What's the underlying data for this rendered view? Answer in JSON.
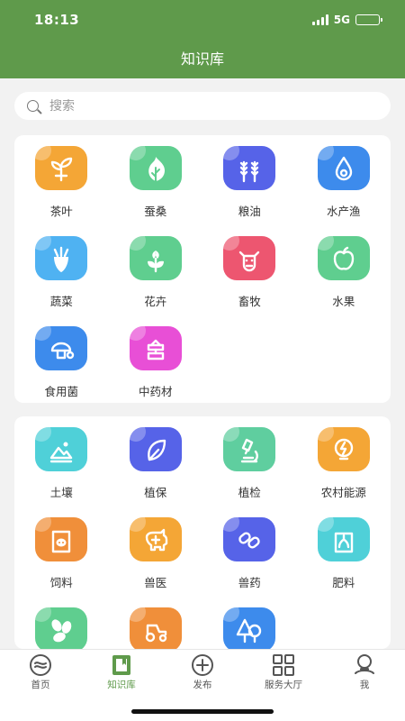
{
  "status": {
    "time": "18:13",
    "network": "5G"
  },
  "header": {
    "title": "知识库"
  },
  "search": {
    "placeholder": "搜索"
  },
  "section1": {
    "items": [
      {
        "label": "茶叶",
        "icon": "tea-sprout-icon",
        "color": "#f4a636"
      },
      {
        "label": "蚕桑",
        "icon": "mulberry-leaf-icon",
        "color": "#5fce8f"
      },
      {
        "label": "粮油",
        "icon": "wheat-icon",
        "color": "#5663e8"
      },
      {
        "label": "水产渔",
        "icon": "water-drop-icon",
        "color": "#3d8bec"
      },
      {
        "label": "蔬菜",
        "icon": "radish-icon",
        "color": "#4fb2f2"
      },
      {
        "label": "花卉",
        "icon": "flower-icon",
        "color": "#5fce8f"
      },
      {
        "label": "畜牧",
        "icon": "cow-icon",
        "color": "#ed5670"
      },
      {
        "label": "水果",
        "icon": "apple-icon",
        "color": "#5fce8f"
      },
      {
        "label": "食用菌",
        "icon": "mushroom-icon",
        "color": "#3d8bec"
      },
      {
        "label": "中药材",
        "icon": "herb-bundle-icon",
        "color": "#e84fd6"
      }
    ]
  },
  "section2": {
    "items": [
      {
        "label": "土壤",
        "icon": "soil-icon",
        "color": "#4fd0d8"
      },
      {
        "label": "植保",
        "icon": "leaf-protect-icon",
        "color": "#5663e8"
      },
      {
        "label": "植检",
        "icon": "microscope-icon",
        "color": "#5fce9f"
      },
      {
        "label": "农村能源",
        "icon": "energy-bulb-icon",
        "color": "#f4a636"
      },
      {
        "label": "饲料",
        "icon": "feed-bag-icon",
        "color": "#f08f3a"
      },
      {
        "label": "兽医",
        "icon": "vet-pig-icon",
        "color": "#f4a636"
      },
      {
        "label": "兽药",
        "icon": "pills-icon",
        "color": "#5663e8"
      },
      {
        "label": "肥料",
        "icon": "fertilizer-icon",
        "color": "#4fd0d8"
      },
      {
        "label": "",
        "icon": "seeds-icon",
        "color": "#5fce8f"
      },
      {
        "label": "",
        "icon": "tractor-icon",
        "color": "#f08f3a"
      },
      {
        "label": "",
        "icon": "forest-icon",
        "color": "#3d8bec"
      }
    ]
  },
  "tabbar": {
    "tabs": [
      {
        "label": "首页",
        "icon": "home-logo-icon"
      },
      {
        "label": "知识库",
        "icon": "book-icon",
        "active": true
      },
      {
        "label": "发布",
        "icon": "plus-circle-icon"
      },
      {
        "label": "服务大厅",
        "icon": "grid-icon"
      },
      {
        "label": "我",
        "icon": "profile-icon"
      }
    ]
  }
}
